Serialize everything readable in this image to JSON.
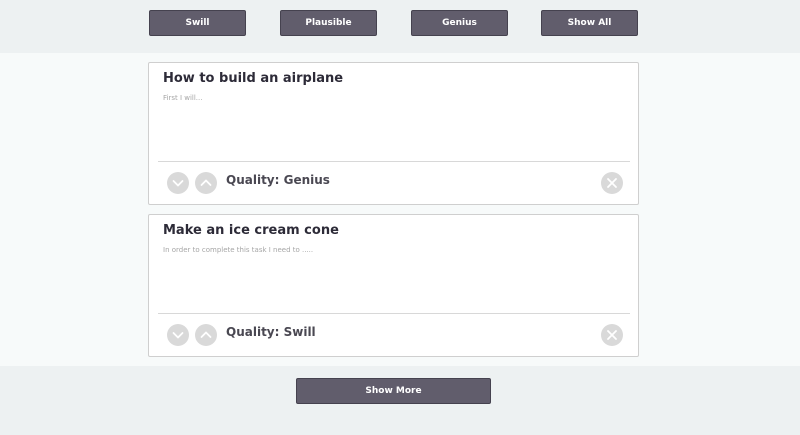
{
  "filters": [
    {
      "label": "Swill"
    },
    {
      "label": "Plausible"
    },
    {
      "label": "Genius"
    },
    {
      "label": "Show All"
    }
  ],
  "ideas": [
    {
      "title": "How to build an airplane",
      "body": "First I will...",
      "quality_label": "Quality: Genius"
    },
    {
      "title": "Make an ice cream cone",
      "body": "In order to complete this task I need to .....",
      "quality_label": "Quality: Swill"
    }
  ],
  "show_more": {
    "label": "Show More"
  },
  "icons": {
    "downvote": "chevron-down-icon",
    "upvote": "chevron-up-icon",
    "delete": "close-icon"
  },
  "colors": {
    "button_bg": "#615d6c",
    "bar_bg": "#edf1f2",
    "card_bg": "#ffffff",
    "icon_bg": "#d9d9d9"
  }
}
